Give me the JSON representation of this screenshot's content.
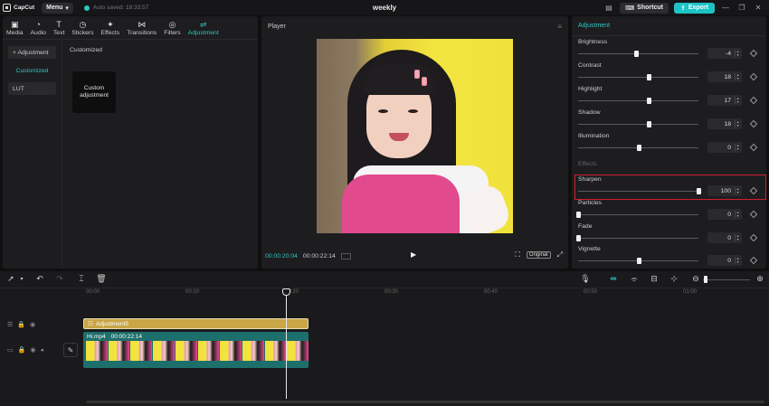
{
  "app": {
    "logo": "CapCut",
    "menu_label": "Menu",
    "autosave": "Auto saved: 18:33:57",
    "project_title": "weekly",
    "shortcut_label": "Shortcut",
    "export_label": "Export",
    "accent_color": "#2fc6c0"
  },
  "tabs": [
    {
      "label": "Media",
      "icon": "media-icon"
    },
    {
      "label": "Audio",
      "icon": "audio-icon"
    },
    {
      "label": "Text",
      "icon": "text-icon"
    },
    {
      "label": "Stickers",
      "icon": "stickers-icon"
    },
    {
      "label": "Effects",
      "icon": "effects-icon"
    },
    {
      "label": "Transitions",
      "icon": "transitions-icon"
    },
    {
      "label": "Filters",
      "icon": "filters-icon"
    },
    {
      "label": "Adjustment",
      "icon": "adjustment-icon",
      "active": true
    }
  ],
  "sidebar": {
    "header": "+ Adjustment",
    "items": [
      "Customized",
      "LUT"
    ]
  },
  "content": {
    "title": "Customized",
    "card_label": "Custom adjustment"
  },
  "player": {
    "title": "Player",
    "current_time": "00:00:20:04",
    "total_time": "00:00:22:14",
    "original_label": "Original"
  },
  "adjustment": {
    "title": "Adjustment",
    "effects_section": "Effects",
    "rows": [
      {
        "label": "Brightness",
        "value": "-4",
        "level": 0.48
      },
      {
        "label": "Contrast",
        "value": "18",
        "level": 0.59
      },
      {
        "label": "Highlight",
        "value": "17",
        "level": 0.585
      },
      {
        "label": "Shadow",
        "value": "18",
        "level": 0.59
      },
      {
        "label": "Illumination",
        "value": "0",
        "level": 0.5
      },
      {
        "label": "Sharpen",
        "value": "100",
        "level": 1.0
      },
      {
        "label": "Particles",
        "value": "0",
        "level": 0.0
      },
      {
        "label": "Fade",
        "value": "0",
        "level": 0.0
      },
      {
        "label": "Vignette",
        "value": "0",
        "level": 0.5
      }
    ],
    "highlight_color": "#d31f2c"
  },
  "timeline": {
    "ticks": [
      "00:00",
      "00:10",
      "00:20",
      "00:30",
      "00:40",
      "00:50",
      "01:00"
    ],
    "adjustment_clip": "Adjustment5",
    "video_clip_name": "Hi.mp4",
    "video_clip_duration": "00:00:22:14"
  }
}
